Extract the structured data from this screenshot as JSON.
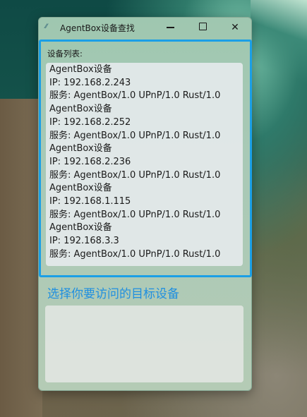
{
  "window": {
    "title": "AgentBox设备查找"
  },
  "controls": {
    "minimize_icon": "minimize-icon",
    "maximize_icon": "maximize-icon",
    "close_icon": "close-icon",
    "close_glyph": "✕"
  },
  "panel": {
    "label": "设备列表:"
  },
  "devices": [
    {
      "name": "AgentBox设备",
      "ip": "IP: 192.168.2.243",
      "service": "服务: AgentBox/1.0 UPnP/1.0 Rust/1.0"
    },
    {
      "name": "AgentBox设备",
      "ip": "IP: 192.168.2.252",
      "service": "服务: AgentBox/1.0 UPnP/1.0 Rust/1.0"
    },
    {
      "name": "AgentBox设备",
      "ip": "IP: 192.168.2.236",
      "service": "服务: AgentBox/1.0 UPnP/1.0 Rust/1.0"
    },
    {
      "name": "AgentBox设备",
      "ip": "IP: 192.168.1.115",
      "service": "服务: AgentBox/1.0 UPnP/1.0 Rust/1.0"
    },
    {
      "name": "AgentBox设备",
      "ip": "IP: 192.168.3.3",
      "service": "服务: AgentBox/1.0 UPnP/1.0 Rust/1.0"
    }
  ],
  "hint": "选择你要访问的目标设备",
  "colors": {
    "accent_border": "#1b9fe6",
    "hint_text": "#1f8fe0"
  }
}
